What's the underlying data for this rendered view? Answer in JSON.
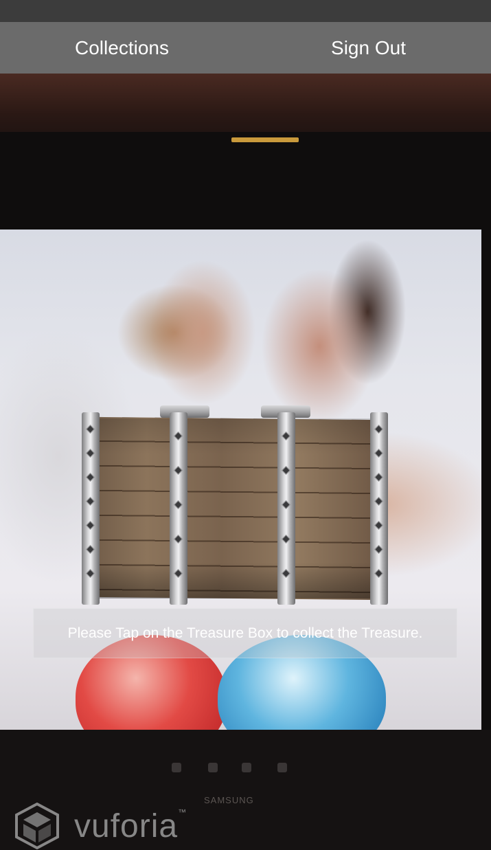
{
  "top_nav": {
    "collections_label": "Collections",
    "signout_label": "Sign Out"
  },
  "instruction": {
    "text": "Please Tap on the Treasure Box to collect the Treasure."
  },
  "watermark": {
    "text": "vuforia",
    "trademark": "™"
  },
  "monitor_brand": "SAMSUNG",
  "colors": {
    "nav_background": "#6b6b6b",
    "status_bar": "#3c3c3c",
    "overlay_text": "#ffffff"
  },
  "icons": {
    "chest": "treasure-chest-icon",
    "watermark_logo": "vuforia-cube-logo"
  }
}
